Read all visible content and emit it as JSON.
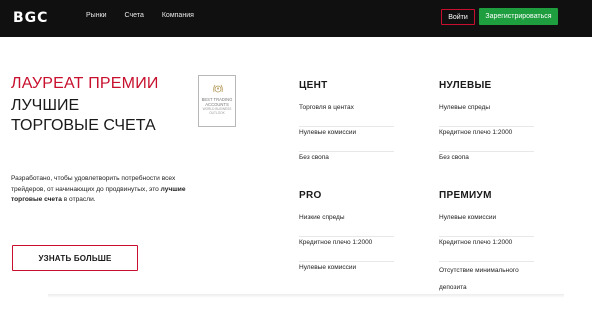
{
  "header": {
    "logo": "BGC",
    "nav": [
      "Рынки",
      "Счета",
      "Компания"
    ],
    "login_label": "Войти",
    "register_label": "Зарегистрироваться"
  },
  "hero": {
    "title_red": "ЛАУРЕАТ ПРЕМИИ",
    "title_black": "ЛУЧШИЕ ТОРГОВЫЕ СЧЕТА",
    "badge_line1": "BEST TRADING ACCOUNTS",
    "badge_line2": "WORLD BUSINESS OUTLOOK",
    "desc_part1": "Разработано, чтобы удовлетворить потребности всех трейдеров, от начинающих до продвинутых, это ",
    "desc_bold": "лучшие торговые счета",
    "desc_part2": " в отрасли.",
    "cta_label": "УЗНАТЬ БОЛЬШЕ"
  },
  "accounts": [
    {
      "title": "ЦЕНТ",
      "features": [
        "Торговля в центах",
        "Нулевые комиссии",
        "Без свопа"
      ]
    },
    {
      "title": "НУЛЕВЫЕ",
      "features": [
        "Нулевые спреды",
        "Кредитное плечо 1:2000",
        "Без свопа"
      ]
    },
    {
      "title": "PRO",
      "features": [
        "Низкие спреды",
        "Кредитное плечо 1:2000",
        "Нулевые комиссии"
      ]
    },
    {
      "title": "ПРЕМИУМ",
      "features": [
        "Нулевые комиссии",
        "Кредитное плечо 1:2000",
        "Отсутствие минимального депозита"
      ]
    }
  ],
  "colors": {
    "brand_red": "#c8102e",
    "register_green": "#1f9e3f",
    "topbar": "#101010"
  }
}
